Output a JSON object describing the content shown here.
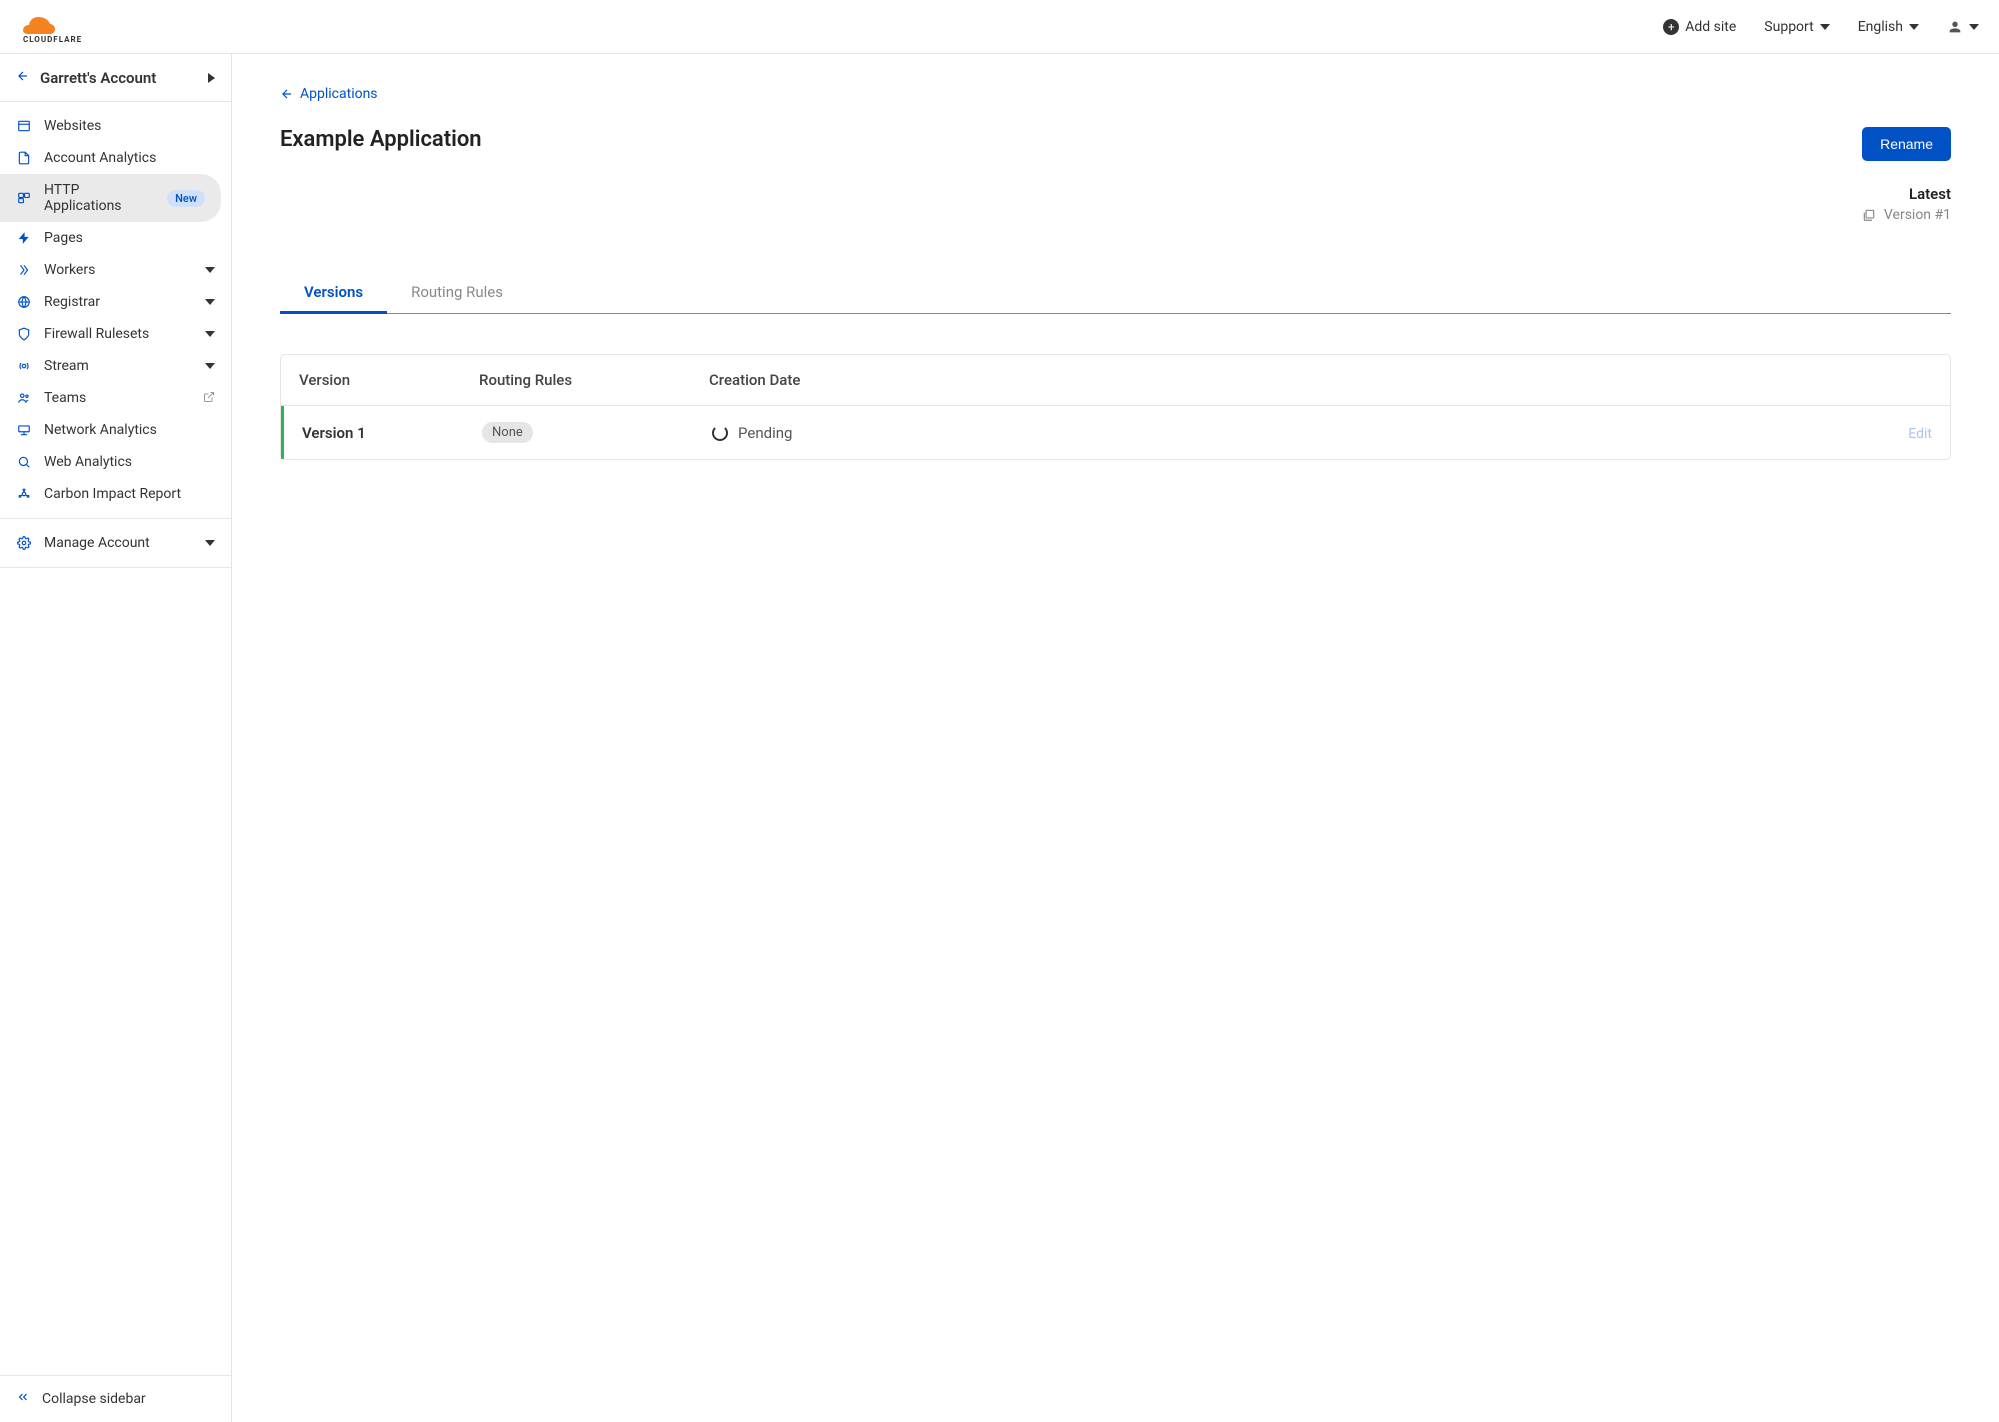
{
  "header": {
    "add_site": "Add site",
    "support": "Support",
    "language": "English"
  },
  "sidebar": {
    "account_name": "Garrett's Account",
    "items": [
      {
        "label": "Websites"
      },
      {
        "label": "Account Analytics"
      },
      {
        "label": "HTTP Applications",
        "badge": "New",
        "active": true
      },
      {
        "label": "Pages"
      },
      {
        "label": "Workers",
        "expandable": true
      },
      {
        "label": "Registrar",
        "expandable": true
      },
      {
        "label": "Firewall Rulesets",
        "expandable": true
      },
      {
        "label": "Stream",
        "expandable": true
      },
      {
        "label": "Teams",
        "external": true
      },
      {
        "label": "Network Analytics"
      },
      {
        "label": "Web Analytics"
      },
      {
        "label": "Carbon Impact Report"
      }
    ],
    "manage_account": "Manage Account",
    "collapse": "Collapse sidebar"
  },
  "main": {
    "breadcrumb": "Applications",
    "title": "Example Application",
    "rename_btn": "Rename",
    "latest_label": "Latest",
    "version_label": "Version #1",
    "tabs": [
      {
        "label": "Versions",
        "active": true
      },
      {
        "label": "Routing Rules",
        "active": false
      }
    ],
    "table": {
      "headers": {
        "version": "Version",
        "rules": "Routing Rules",
        "date": "Creation Date"
      },
      "row": {
        "version": "Version 1",
        "rules_pill": "None",
        "status": "Pending",
        "edit": "Edit"
      }
    }
  }
}
